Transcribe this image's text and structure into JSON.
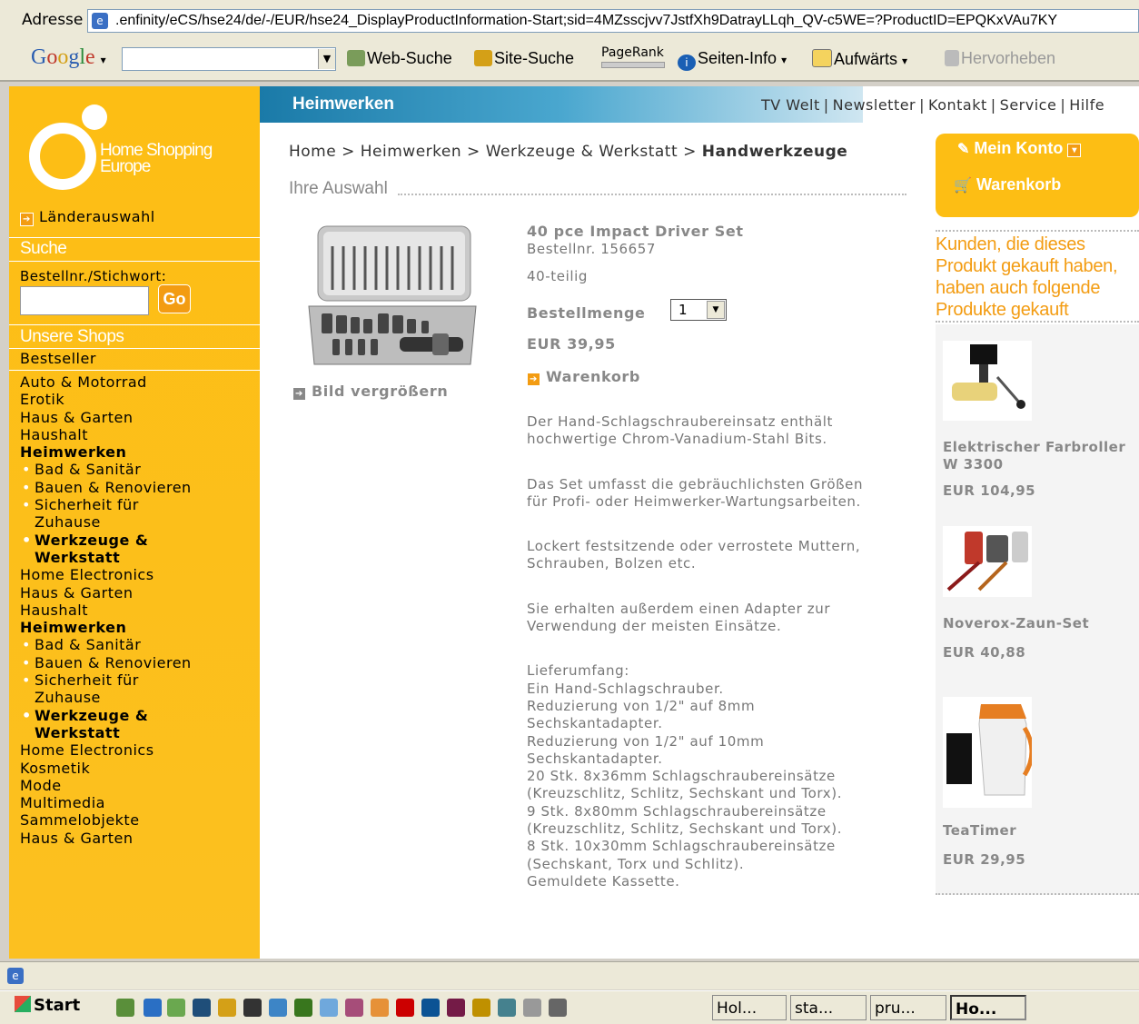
{
  "browser": {
    "address_label": "Adresse",
    "url": ".enfinity/eCS/hse24/de/-/EUR/hse24_DisplayProductInformation-Start;sid=4MZsscjvv7JstfXh9DatrayLLqh_QV-c5WE=?ProductID=EPQKxVAu7KY",
    "google_logo": "Google",
    "google_buttons": [
      "Web-Suche",
      "Site-Suche",
      "PageRank",
      "Seiten-Info",
      "Aufwärts",
      "Hervorheben"
    ]
  },
  "header": {
    "section_title": "Heimwerken",
    "links": [
      "TV Welt",
      "Newsletter",
      "Kontakt",
      "Service",
      "Hilfe"
    ]
  },
  "sidebar": {
    "logo_line1": "Home Shopping",
    "logo_line2": "Europe",
    "country": "Länderauswahl",
    "search_head": "Suche",
    "search_label": "Bestellnr./Stichwort:",
    "go_label": "Go",
    "shops_head": "Unsere Shops",
    "bestseller": "Bestseller",
    "nav": [
      {
        "label": "Auto & Motorrad",
        "kind": "top"
      },
      {
        "label": "Erotik",
        "kind": "top"
      },
      {
        "label": "Haus & Garten",
        "kind": "top"
      },
      {
        "label": "Haushalt",
        "kind": "top"
      },
      {
        "label": "Heimwerken",
        "kind": "bold"
      },
      {
        "label": "Bad & Sanitär",
        "kind": "sub"
      },
      {
        "label": "Bauen & Renovieren",
        "kind": "sub"
      },
      {
        "label": "Sicherheit für",
        "kind": "sub"
      },
      {
        "label": "Zuhause",
        "kind": "cont"
      },
      {
        "label": "Werkzeuge &",
        "kind": "subbold"
      },
      {
        "label": "Werkstatt",
        "kind": "contbold"
      },
      {
        "label": "Home Electronics",
        "kind": "top"
      },
      {
        "label": "Haus & Garten",
        "kind": "top"
      },
      {
        "label": "Haushalt",
        "kind": "top"
      },
      {
        "label": "Heimwerken",
        "kind": "bold"
      },
      {
        "label": "Bad & Sanitär",
        "kind": "sub"
      },
      {
        "label": "Bauen & Renovieren",
        "kind": "sub"
      },
      {
        "label": "Sicherheit für",
        "kind": "sub"
      },
      {
        "label": "Zuhause",
        "kind": "cont"
      },
      {
        "label": "Werkzeuge &",
        "kind": "subbold"
      },
      {
        "label": "Werkstatt",
        "kind": "contbold"
      },
      {
        "label": "Home Electronics",
        "kind": "top"
      },
      {
        "label": "Kosmetik",
        "kind": "top"
      },
      {
        "label": "Mode",
        "kind": "top"
      },
      {
        "label": "Multimedia",
        "kind": "top"
      },
      {
        "label": "Sammelobjekte",
        "kind": "top"
      },
      {
        "label": "Haus & Garten",
        "kind": "top"
      }
    ]
  },
  "breadcrumb": {
    "items": [
      "Home",
      "Heimwerken",
      "Werkzeuge & Werkstatt"
    ],
    "current": "Handwerkzeuge",
    "separator": ">"
  },
  "selection_title": "Ihre Auswahl",
  "product": {
    "name": "40 pce Impact Driver Set",
    "order_no": "Bestellnr. 156657",
    "pieces": "40-teilig",
    "quantity_label": "Bestellmenge",
    "quantity_value": "1",
    "price": "EUR 39,95",
    "cart_label": "Warenkorb",
    "enlarge_label": "Bild vergrößern",
    "description": [
      [
        "Der Hand-Schlagschraubereinsatz enthält",
        "hochwertige Chrom-Vanadium-Stahl Bits."
      ],
      [
        "Das Set umfasst die gebräuchlichsten Größen",
        "für Profi- oder Heimwerker-Wartungsarbeiten."
      ],
      [
        "Lockert festsitzende oder verrostete Muttern,",
        "Schrauben, Bolzen etc."
      ],
      [
        "Sie erhalten außerdem einen Adapter zur",
        "Verwendung der meisten Einsätze."
      ],
      [
        "Lieferumfang:",
        "Ein Hand-Schlagschrauber.",
        "Reduzierung von 1/2\" auf 8mm",
        "Sechskantadapter.",
        "Reduzierung von 1/2\" auf 10mm",
        "Sechskantadapter.",
        "20 Stk. 8x36mm Schlagschraubereinsätze",
        "(Kreuzschlitz, Schlitz, Sechskant und Torx).",
        "9 Stk. 8x80mm Schlagschraubereinsätze",
        "(Kreuzschlitz, Schlitz, Sechskant und Torx).",
        "8 Stk. 10x30mm Schlagschraubereinsätze",
        "(Sechskant, Torx und Schlitz).",
        "Gemuldete Kassette."
      ]
    ]
  },
  "account": {
    "konto": "Mein Konto",
    "cart": "Warenkorb"
  },
  "recommendations": {
    "heading": [
      "Kunden, die dieses",
      "Produkt gekauft haben,",
      "haben auch folgende",
      "Produkte gekauft"
    ],
    "items": [
      {
        "name_lines": [
          "Elektrischer Farbroller",
          "W 3300"
        ],
        "price": "EUR 104,95"
      },
      {
        "name_lines": [
          "Noverox-Zaun-Set"
        ],
        "price": "EUR 40,88"
      },
      {
        "name_lines": [
          "TeaTimer"
        ],
        "price": "EUR 29,95"
      }
    ]
  },
  "taskbar": {
    "start": "Start",
    "tasks": [
      "Hol...",
      "sta...",
      "pru...",
      "Ho..."
    ]
  }
}
